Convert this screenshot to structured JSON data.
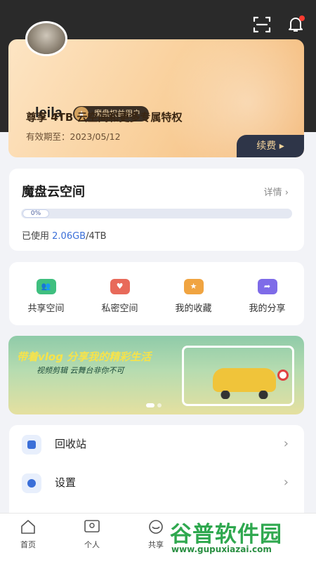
{
  "header": {
    "scan_icon": "scan-icon",
    "bell_icon": "bell-icon"
  },
  "member": {
    "username": "leila",
    "badge_label": "魔盘权益用户",
    "privilege_text": "尊享 4TB 云空间和更多专属特权",
    "expiry_text": "有效期至：2023/05/12",
    "renew_label": "续费 ▸"
  },
  "storage": {
    "title": "魔盘云空间",
    "detail_label": "详情",
    "percent_label": "0%",
    "usage_prefix": "已使用 ",
    "used": "2.06GB",
    "total": "/4TB"
  },
  "quick": [
    {
      "label": "共享空间",
      "icon": "shared-space-icon",
      "color": "#3fbf7f"
    },
    {
      "label": "私密空间",
      "icon": "private-space-icon",
      "color": "#e86a5a"
    },
    {
      "label": "我的收藏",
      "icon": "favorites-icon",
      "color": "#f0a441"
    },
    {
      "label": "我的分享",
      "icon": "my-share-icon",
      "color": "#7e6be8"
    }
  ],
  "banner": {
    "title": "带着vlog 分享我的精彩生活",
    "subtitle": "视频剪辑 云舞台非你不可"
  },
  "list": [
    {
      "label": "回收站",
      "icon": "trash-icon"
    },
    {
      "label": "设置",
      "icon": "settings-icon"
    }
  ],
  "tabs": [
    {
      "label": "首页",
      "icon": "home-icon"
    },
    {
      "label": "个人",
      "icon": "profile-icon"
    },
    {
      "label": "共享",
      "icon": "share-icon"
    }
  ],
  "watermark": {
    "title": "谷普软件园",
    "url": "www.gupuxiazai.com"
  }
}
